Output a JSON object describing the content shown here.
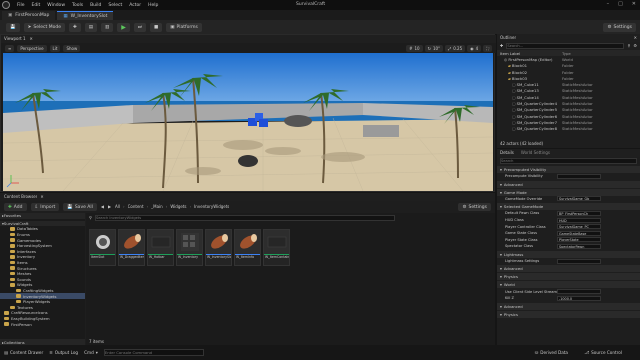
{
  "app": {
    "title": "SurvivalCraft"
  },
  "menu": [
    "File",
    "Edit",
    "Window",
    "Tools",
    "Build",
    "Select",
    "Actor",
    "Help"
  ],
  "tabs": [
    {
      "label": "FirstPersonMap",
      "active": false
    },
    {
      "label": "W_InventorySlot",
      "active": true
    }
  ],
  "toolbar": {
    "select_mode": "Select Mode",
    "platforms": "Platforms",
    "settings": "Settings"
  },
  "viewport": {
    "title": "Viewport 1",
    "perspective": "Perspective",
    "lit": "Lit",
    "show": "Show",
    "grid_snap": "10",
    "rot_snap": "10°",
    "scale_snap": "0.25",
    "cam_speed": "4"
  },
  "outliner": {
    "title": "Outliner",
    "search_placeholder": "Search...",
    "col_label": "Item Label",
    "col_type": "Type",
    "rows": [
      {
        "label": "FirstPersonMap (Editor)",
        "type": "World",
        "indent": 1,
        "kind": "world"
      },
      {
        "label": "Block01",
        "type": "Folder",
        "indent": 2,
        "kind": "folder"
      },
      {
        "label": "Block02",
        "type": "Folder",
        "indent": 2,
        "kind": "folder"
      },
      {
        "label": "Block03",
        "type": "Folder",
        "indent": 2,
        "kind": "folder"
      },
      {
        "label": "SM_Cube11",
        "type": "StaticMeshActor",
        "indent": 3,
        "kind": "mesh"
      },
      {
        "label": "SM_Cube13",
        "type": "StaticMeshActor",
        "indent": 3,
        "kind": "mesh"
      },
      {
        "label": "SM_Cube14",
        "type": "StaticMeshActor",
        "indent": 3,
        "kind": "mesh"
      },
      {
        "label": "SM_QuarterCylinder4",
        "type": "StaticMeshActor",
        "indent": 3,
        "kind": "mesh"
      },
      {
        "label": "SM_QuarterCylinder5",
        "type": "StaticMeshActor",
        "indent": 3,
        "kind": "mesh"
      },
      {
        "label": "SM_QuarterCylinder6",
        "type": "StaticMeshActor",
        "indent": 3,
        "kind": "mesh"
      },
      {
        "label": "SM_QuarterCylinder7",
        "type": "StaticMeshActor",
        "indent": 3,
        "kind": "mesh"
      },
      {
        "label": "SM_QuarterCylinder8",
        "type": "StaticMeshActor",
        "indent": 3,
        "kind": "mesh"
      }
    ],
    "footer": "42 actors (42 loaded)"
  },
  "details": {
    "tab_details": "Details",
    "tab_world": "World Settings",
    "search_placeholder": "Search",
    "sections": [
      {
        "title": "Precomputed Visibility",
        "rows": [
          {
            "label": "Precompute Visibility",
            "value": ""
          }
        ]
      },
      {
        "title": "Advanced",
        "rows": []
      },
      {
        "title": "Game Mode",
        "rows": [
          {
            "label": "GameMode Override",
            "value": "SurvivalGame_Gb"
          }
        ]
      },
      {
        "title": "Selected GameMode",
        "rows": [
          {
            "label": "Default Pawn Class",
            "value": "BP_FirstPersonCh"
          },
          {
            "label": "HUD Class",
            "value": "HUD"
          },
          {
            "label": "Player Controller Class",
            "value": "SurvivalGame_PC"
          },
          {
            "label": "Game State Class",
            "value": "GameStateBase"
          },
          {
            "label": "Player State Class",
            "value": "PlayerState"
          },
          {
            "label": "Spectator Class",
            "value": "SpectatorPawn"
          }
        ]
      },
      {
        "title": "Lightmass",
        "rows": [
          {
            "label": "Lightmass Settings",
            "value": ""
          }
        ]
      },
      {
        "title": "Advanced",
        "rows": []
      },
      {
        "title": "Physics",
        "rows": []
      },
      {
        "title": "World",
        "rows": [
          {
            "label": "Use Client Side Level Streaming V...",
            "value": ""
          },
          {
            "label": "Kill Z",
            "value": "-1000.0"
          }
        ]
      },
      {
        "title": "Advanced",
        "rows": []
      },
      {
        "title": "Physics",
        "rows": []
      }
    ]
  },
  "content_browser": {
    "title": "Content Browser",
    "add": "Add",
    "import": "Import",
    "save_all": "Save All",
    "breadcrumb": [
      "All",
      "Content",
      "_Main",
      "Widgets",
      "InventoryWidgets"
    ],
    "settings": "Settings",
    "favorites": "Favorites",
    "project": "SurvivalCraft",
    "search_placeholder": "Search InventoryWidgets",
    "tree": [
      {
        "label": "DataTables",
        "indent": 1
      },
      {
        "label": "Enums",
        "indent": 1
      },
      {
        "label": "Gamemodes",
        "indent": 1
      },
      {
        "label": "HarvestingSystem",
        "indent": 1
      },
      {
        "label": "Interfaces",
        "indent": 1
      },
      {
        "label": "Inventory",
        "indent": 1
      },
      {
        "label": "Items",
        "indent": 1
      },
      {
        "label": "Structures",
        "indent": 1
      },
      {
        "label": "Meshes",
        "indent": 1
      },
      {
        "label": "Sounds",
        "indent": 1
      },
      {
        "label": "Widgets",
        "indent": 1
      },
      {
        "label": "CraftingWidgets",
        "indent": 2
      },
      {
        "label": "InventoryWidgets",
        "indent": 2,
        "selected": true
      },
      {
        "label": "PlayerWidgets",
        "indent": 2
      },
      {
        "label": "Textures",
        "indent": 1
      },
      {
        "label": "CraftResourceIcons",
        "indent": 0
      },
      {
        "label": "EasyBuildingSystem",
        "indent": 0
      },
      {
        "label": "FirstPerson",
        "indent": 0
      }
    ],
    "assets": [
      {
        "name": "ItemSlot",
        "thumb": "circle"
      },
      {
        "name": "W_DraggedItem",
        "thumb": "log"
      },
      {
        "name": "W_Hotbar",
        "thumb": "dark"
      },
      {
        "name": "W_Inventory",
        "thumb": "grid"
      },
      {
        "name": "W_InventorySlot",
        "thumb": "log"
      },
      {
        "name": "W_ItemInfo",
        "thumb": "log"
      },
      {
        "name": "W_ItemContainerGrid",
        "thumb": "dark"
      }
    ],
    "item_count": "7 items",
    "collections": "Collections"
  },
  "statusbar": {
    "content_drawer": "Content Drawer",
    "output_log": "Output Log",
    "cmd": "Cmd",
    "cmd_placeholder": "Enter Console Command",
    "derived_data": "Derived Data",
    "source_control": "Source Control"
  },
  "colors": {
    "accent": "#3b82f6",
    "folder": "#c9a44a",
    "sky": "#2f7fd6",
    "sea": "#1d6fb8",
    "sand": "#d9c9a8"
  }
}
